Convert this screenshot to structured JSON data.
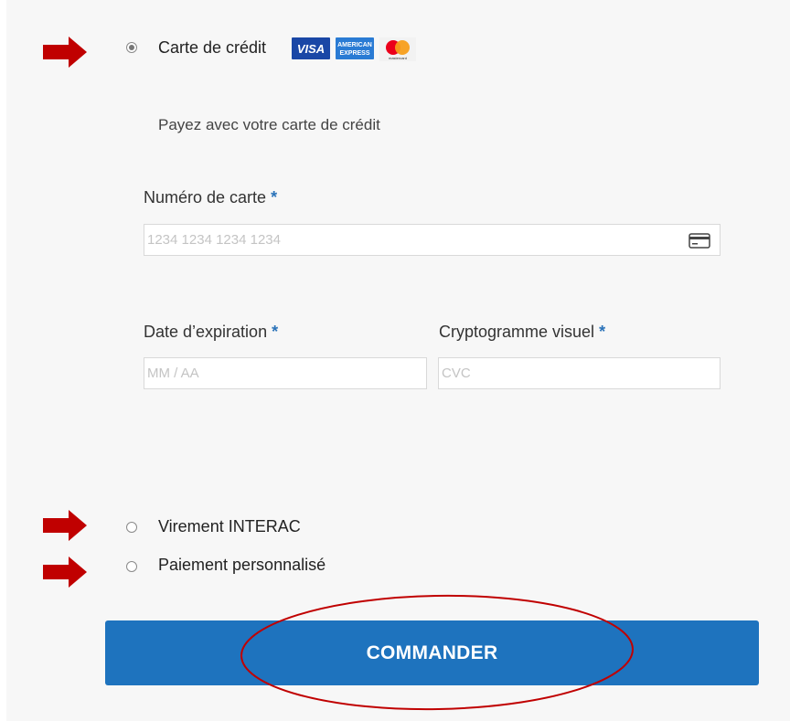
{
  "payment_methods": [
    {
      "label": "Carte de crédit",
      "selected": true
    },
    {
      "label": "Virement INTERAC",
      "selected": false
    },
    {
      "label": "Paiement personnalisé",
      "selected": false
    }
  ],
  "card_logos": {
    "visa": "VISA",
    "amex_line1": "AMERICAN",
    "amex_line2": "EXPRESS",
    "mastercard": "mastercard"
  },
  "credit_card": {
    "description": "Payez avec votre carte de crédit",
    "card_number": {
      "label": "Numéro de carte",
      "placeholder": "1234 1234 1234 1234"
    },
    "expiry": {
      "label": "Date d’expiration",
      "placeholder": "MM / AA"
    },
    "cvc": {
      "label": "Cryptogramme visuel",
      "placeholder": "CVC"
    },
    "required_mark": "*"
  },
  "submit": {
    "label": "COMMANDER"
  },
  "colors": {
    "accent": "#1e73be",
    "annotation_red": "#c00000",
    "panel_bg": "#f7f7f7"
  },
  "icons": [
    "right-arrow-annotation",
    "credit-card-icon",
    "radio-icon"
  ]
}
